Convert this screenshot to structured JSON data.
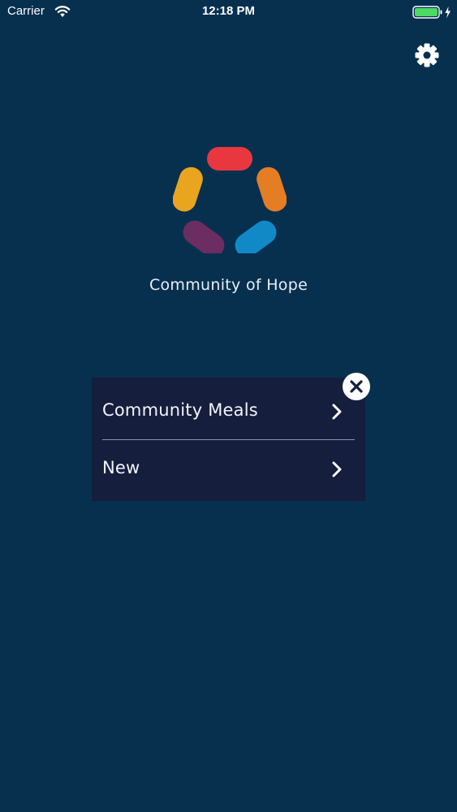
{
  "status_bar": {
    "carrier": "Carrier",
    "time": "12:18 PM",
    "wifi_icon": "wifi-icon",
    "battery_icon": "battery-full-charging-icon"
  },
  "header": {
    "settings_icon": "gear-icon"
  },
  "app": {
    "title": "Community of Hope",
    "logo_colors": [
      "#e9373f",
      "#e57d25",
      "#1189c7",
      "#6b2d62",
      "#eaa51e"
    ]
  },
  "menu": {
    "items": [
      {
        "label": "Community Meals",
        "icon": "chevron-right-icon"
      },
      {
        "label": "New",
        "icon": "chevron-right-icon"
      }
    ],
    "close_icon": "close-icon"
  },
  "colors": {
    "background": "#07304f",
    "panel": "#151e3d",
    "battery": "#4cd964"
  }
}
